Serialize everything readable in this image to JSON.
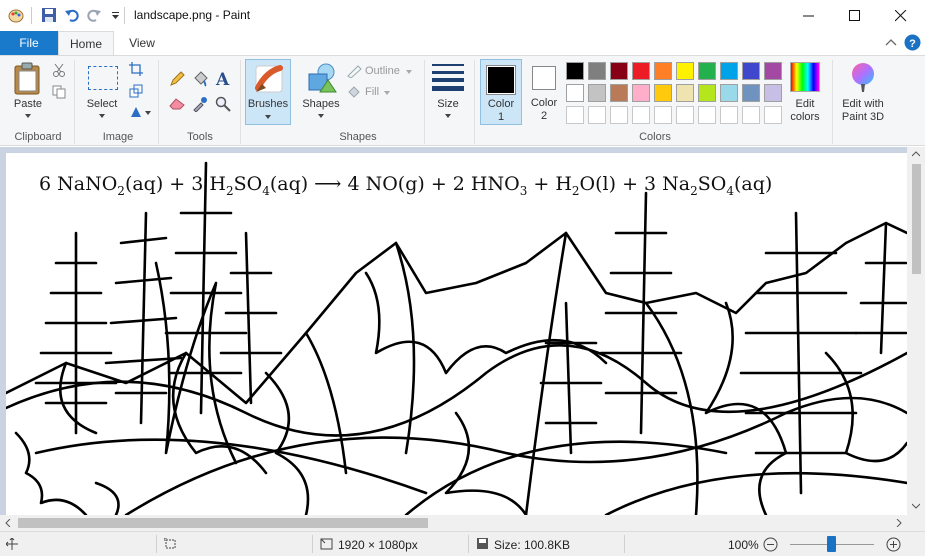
{
  "window": {
    "title": "landscape.png - Paint"
  },
  "icons": {
    "app": "paint-app-icon",
    "save": "save-icon",
    "undo": "undo-icon",
    "redo": "redo-icon",
    "customize": "dropdown-icon",
    "minimize": "minimize-icon",
    "maximize": "maximize-icon",
    "close": "close-icon",
    "help": "help-icon",
    "collapse": "chevron-up-icon"
  },
  "tabs": {
    "file": "File",
    "home": "Home",
    "view": "View"
  },
  "ribbon": {
    "clipboard": {
      "paste": "Paste",
      "group": "Clipboard"
    },
    "image": {
      "select": "Select",
      "group": "Image"
    },
    "tools": {
      "group": "Tools"
    },
    "brushes": {
      "label": "Brushes"
    },
    "shapes": {
      "label": "Shapes",
      "outline": "Outline",
      "fill": "Fill",
      "group": "Shapes"
    },
    "size": {
      "label": "Size"
    },
    "colors": {
      "color1": "Color",
      "color1_num": "1",
      "color2": "Color",
      "color2_num": "2",
      "edit": "Edit",
      "edit2": "colors",
      "paint3d": "Edit with",
      "paint3d2": "Paint 3D",
      "group": "Colors",
      "color1_value": "#000000",
      "color2_value": "#ffffff",
      "palette_row1": [
        "#000000",
        "#7f7f7f",
        "#880015",
        "#ed1c24",
        "#ff7f27",
        "#fff200",
        "#22b14c",
        "#00a2e8",
        "#3f48cc",
        "#a349a4"
      ],
      "palette_row2": [
        "#ffffff",
        "#c3c3c3",
        "#b97a57",
        "#ffaec9",
        "#ffc90e",
        "#efe4b0",
        "#b5e61d",
        "#99d9ea",
        "#7092be",
        "#c8bfe7"
      ]
    }
  },
  "canvas": {
    "equation": {
      "p1": "6 NaNO",
      "s1": "2",
      "p2": "(aq) + 3 H",
      "s2": "2",
      "p3": "SO",
      "s3": "4",
      "p4": "(aq) ⟶ 4 NO(g) + 2 HNO",
      "s4": "3",
      "p5": " + H",
      "s5": "2",
      "p6": "O(l) + 3 Na",
      "s6": "2",
      "p7": "SO",
      "s7": "4",
      "p8": "(aq)"
    }
  },
  "status": {
    "dimensions": "1920 × 1080px",
    "size": "Size: 100.8KB",
    "zoom": "100%"
  }
}
